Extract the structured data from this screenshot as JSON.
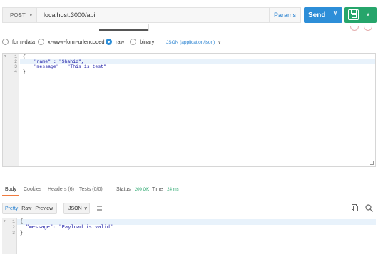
{
  "request": {
    "method": "POST",
    "url": "localhost:3000/api",
    "params_label": "Params",
    "send_label": "Send"
  },
  "body_types": [
    {
      "label": "form-data",
      "selected": false
    },
    {
      "label": "x-www-form-urlencoded",
      "selected": false
    },
    {
      "label": "raw",
      "selected": true
    },
    {
      "label": "binary",
      "selected": false
    }
  ],
  "content_type": "JSON (application/json)",
  "request_editor": {
    "line_numbers": [
      "1",
      "2",
      "3",
      "4"
    ],
    "lines": [
      "{",
      "    \"name\" : \"Shahid\",",
      "    \"message\" : \"This is test\"",
      "}"
    ]
  },
  "response": {
    "tabs": [
      "Body",
      "Cookies",
      "Headers (6)",
      "Tests (0/0)"
    ],
    "active_tab": "Body",
    "status_label": "Status",
    "status_value": "200 OK",
    "time_label": "Time",
    "time_value": "24 ms",
    "format_modes": [
      "Pretty",
      "Raw",
      "Preview"
    ],
    "selected_mode": "Pretty",
    "language": "JSON",
    "line_numbers": [
      "1",
      "2",
      "3"
    ],
    "lines": [
      "{",
      "  \"message\": \"Payload is valid\"",
      "}"
    ]
  },
  "colors": {
    "accent": "#2d8ed8",
    "save": "#26a56b",
    "status_ok": "#26a56b",
    "tab_active": "#f07b3f"
  },
  "icons": [
    "chevron-down-icon",
    "save-icon",
    "wrap-lines-icon",
    "copy-icon",
    "search-icon",
    "fold-arrow-icon",
    "resize-handle-icon"
  ]
}
